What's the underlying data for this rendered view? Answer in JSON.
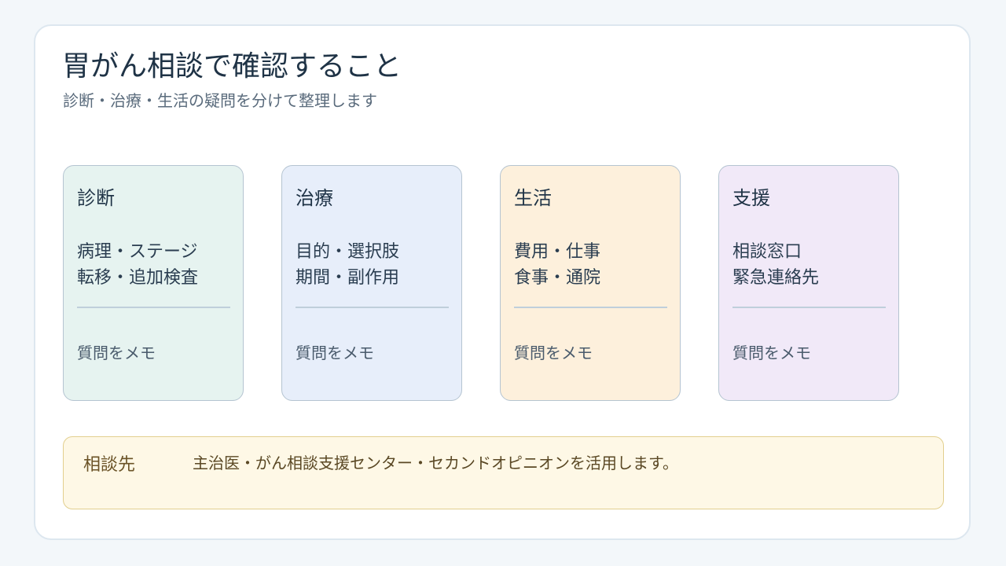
{
  "header": {
    "title": "胃がん相談で確認すること",
    "subtitle": "診断・治療・生活の疑問を分けて整理します"
  },
  "cards": [
    {
      "title": "診断",
      "lines": [
        "病理・ステージ",
        "転移・追加検査"
      ],
      "memo": "質問をメモ",
      "color": "#e6f3f0"
    },
    {
      "title": "治療",
      "lines": [
        "目的・選択肢",
        "期間・副作用"
      ],
      "memo": "質問をメモ",
      "color": "#e7eefa"
    },
    {
      "title": "生活",
      "lines": [
        "費用・仕事",
        "食事・通院"
      ],
      "memo": "質問をメモ",
      "color": "#fdf0dc"
    },
    {
      "title": "支援",
      "lines": [
        "相談窓口",
        "緊急連絡先"
      ],
      "memo": "質問をメモ",
      "color": "#f1e9f8"
    }
  ],
  "footer": {
    "label": "相談先",
    "text": "主治医・がん相談支援センター・セカンドオピニオンを活用します。",
    "color": "#fef8e6"
  }
}
